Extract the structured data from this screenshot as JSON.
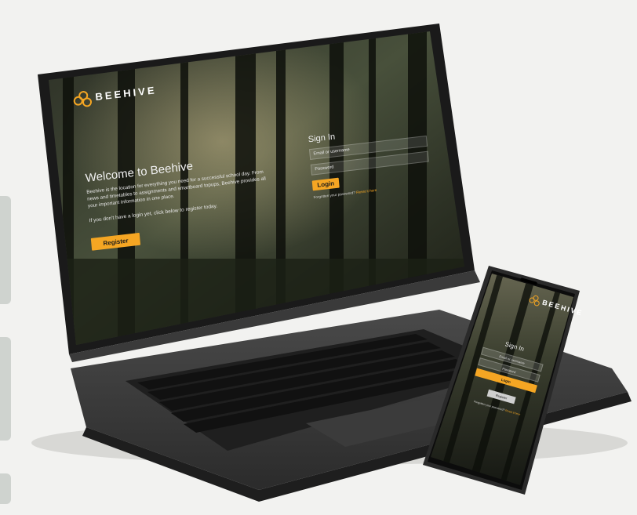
{
  "app": {
    "brand": "BEEHIVE",
    "accent_color": "#f5a623"
  },
  "welcome": {
    "title": "Welcome to Beehive",
    "body": "Beehive is the location for everything you need for a successful school day. From news and timetables to assignments and smartboard topups, Beehive provides all your important information in one place.",
    "cta_text": "If you don't have a login yet, click below to register today.",
    "register_label": "Register"
  },
  "signin": {
    "title": "Sign In",
    "email_placeholder": "Email or username",
    "password_placeholder": "Password",
    "login_label": "Login",
    "forgot_text": "Forgotten your password?",
    "reset_link": "Reset it here"
  },
  "phone": {
    "brand": "BEEHIVE",
    "title": "Sign In",
    "email_placeholder": "Email or username",
    "password_placeholder": "Password",
    "login_label": "Login",
    "register_label": "Register",
    "forgot_text": "Forgotten your password?",
    "reset_link": "Reset it here"
  }
}
